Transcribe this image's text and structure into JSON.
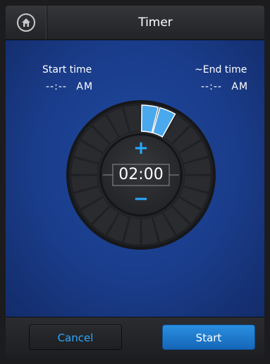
{
  "header": {
    "title": "Timer",
    "home_icon": "home-icon"
  },
  "start": {
    "label": "Start time",
    "value": "--:--",
    "ampm": "AM"
  },
  "end": {
    "label": "~End time",
    "value": "--:--",
    "ampm": "AM"
  },
  "dial": {
    "plus": "+",
    "minus": "−",
    "duration": "02:00",
    "segments_total": 24,
    "segments_selected": 2,
    "accent": "#4aa8ec"
  },
  "footer": {
    "cancel_label": "Cancel",
    "start_label": "Start"
  },
  "colors": {
    "accent": "#29a9ff",
    "start_button": "#1f7bcf",
    "background": "#1a3c8a"
  }
}
